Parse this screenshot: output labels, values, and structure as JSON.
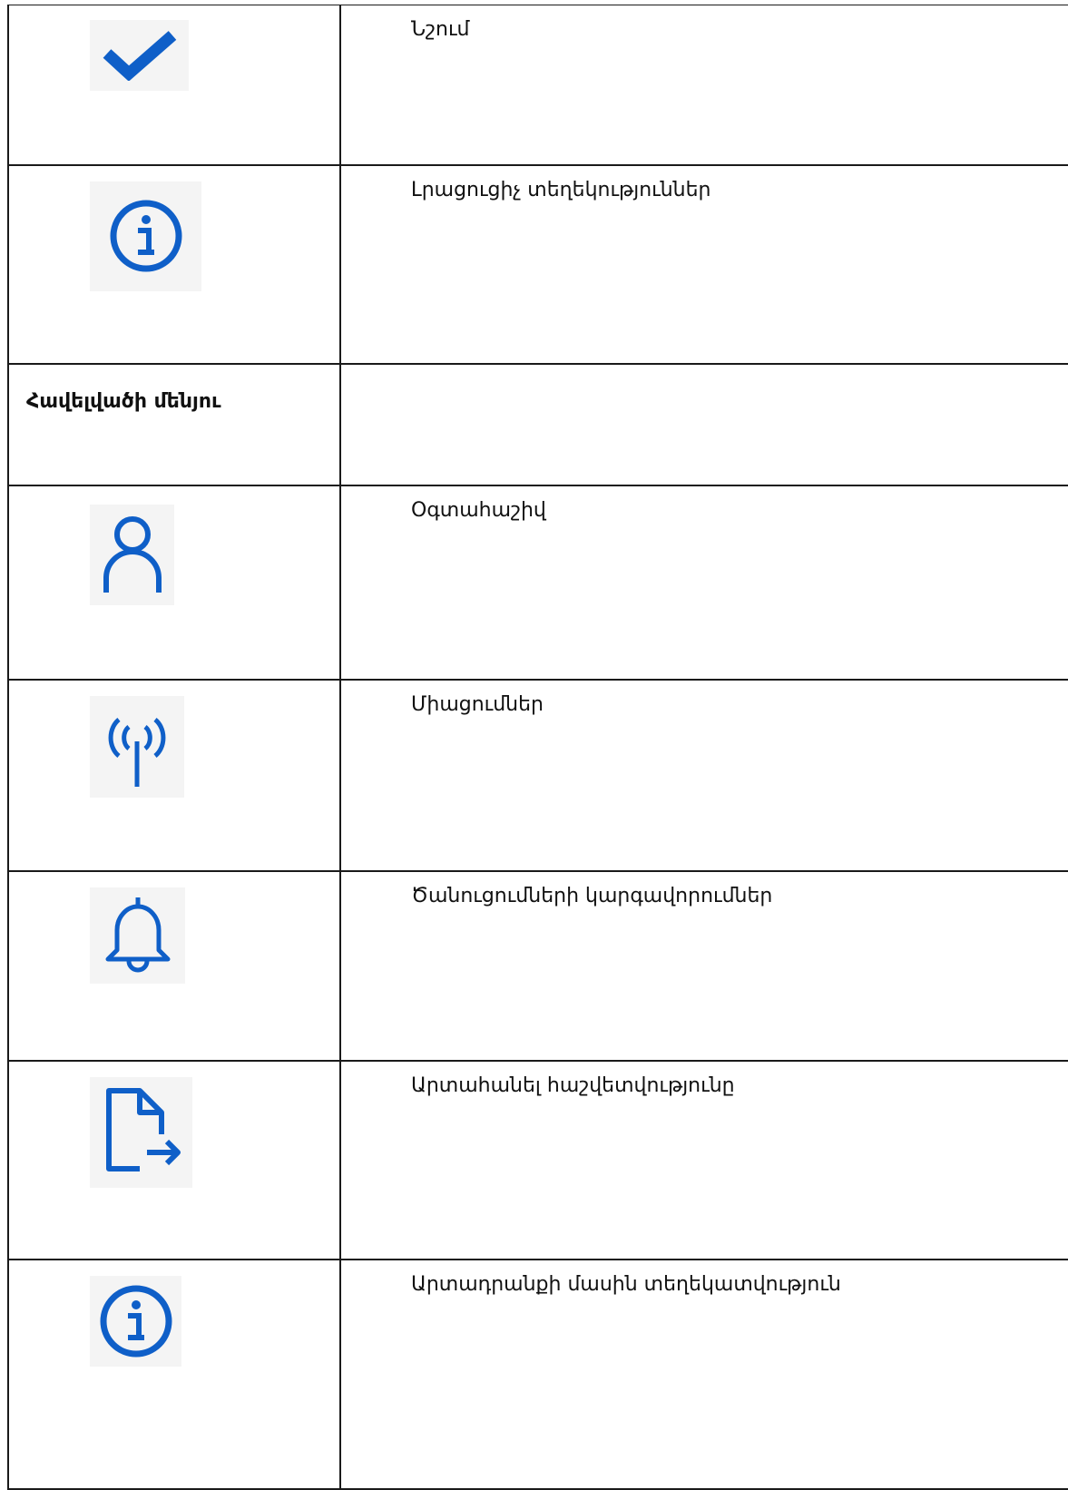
{
  "colors": {
    "border": "#1a1a1a",
    "icon_blue": "#0f5fc8",
    "tile_bg": "#f4f4f4",
    "text": "#111111"
  },
  "rows": [
    {
      "icon": "checkmark-icon",
      "label": "Նշում"
    },
    {
      "icon": "info-icon",
      "label": "Լրացուցիչ տեղեկություններ"
    }
  ],
  "section": {
    "title": "Հավելվածի մենյու"
  },
  "menu_rows": [
    {
      "icon": "user-icon",
      "label": "Օգտահաշիվ"
    },
    {
      "icon": "antenna-icon",
      "label": "Միացումներ"
    },
    {
      "icon": "bell-icon",
      "label": "Ծանուցումների կարգավորումներ"
    },
    {
      "icon": "export-document-icon",
      "label": "Արտահանել հաշվետվությունը"
    },
    {
      "icon": "info-icon",
      "label": "Արտադրանքի մասին տեղեկատվություն"
    }
  ]
}
